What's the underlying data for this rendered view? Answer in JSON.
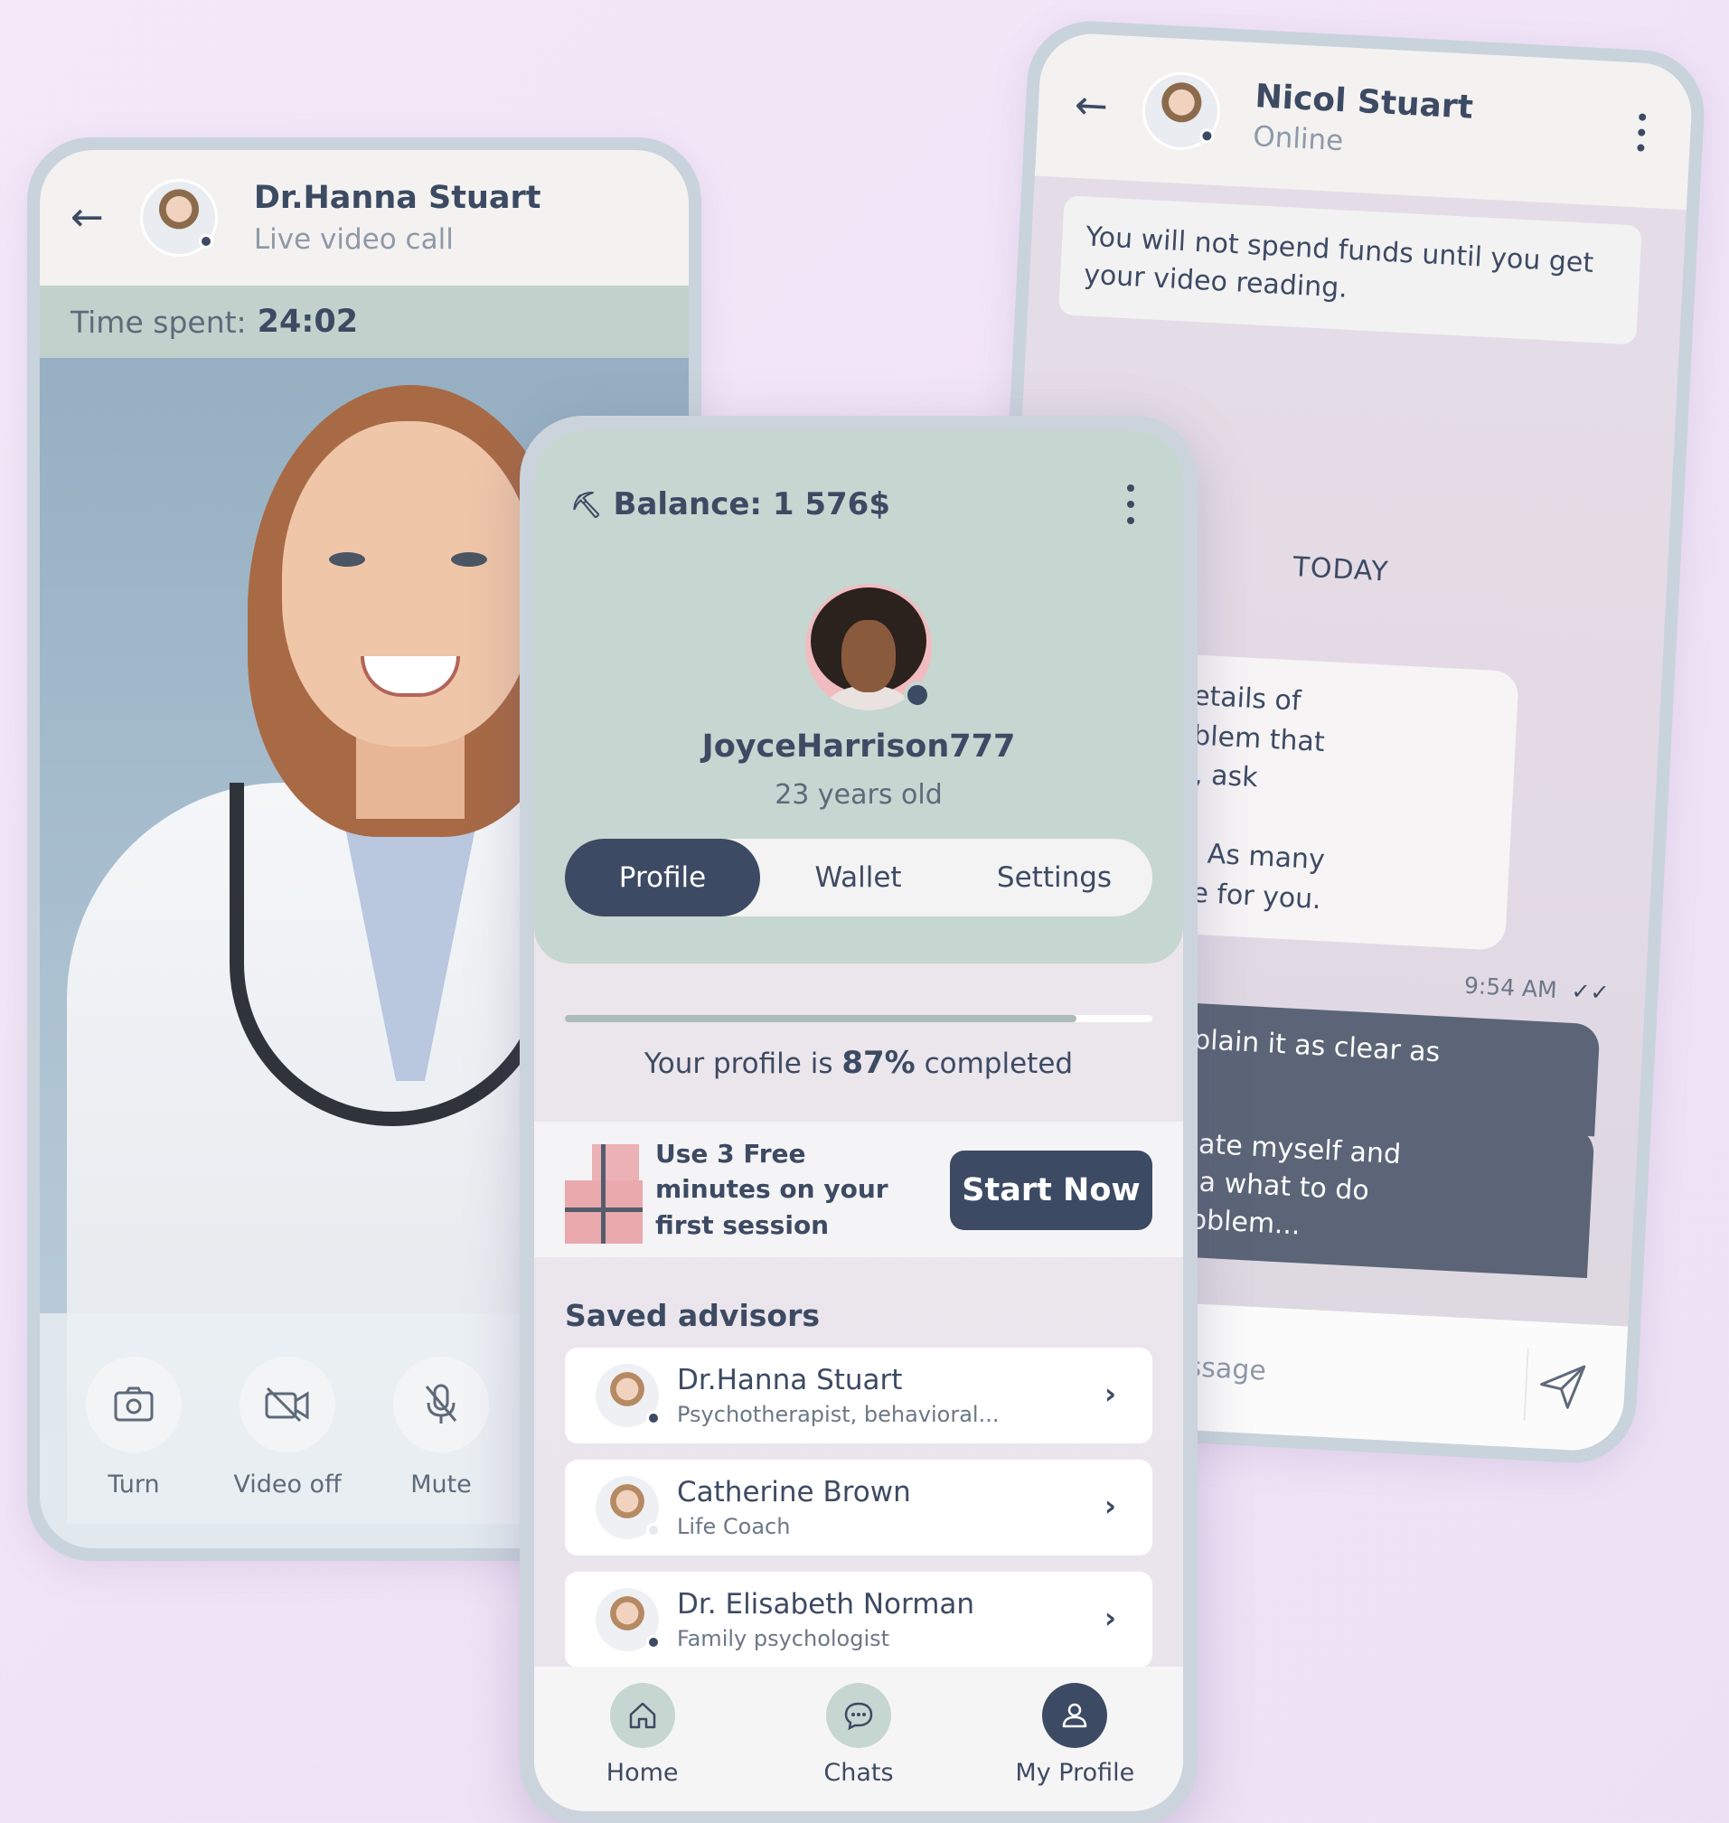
{
  "video_call": {
    "doctor_name": "Dr.Hanna Stuart",
    "status": "Live video call",
    "time_label": "Time spent:",
    "time_value": "24:02",
    "controls": [
      {
        "label": "Turn",
        "icon": "camera-rotate-icon"
      },
      {
        "label": "Video off",
        "icon": "video-off-icon"
      },
      {
        "label": "Mute",
        "icon": "mic-off-icon"
      }
    ]
  },
  "chat": {
    "contact_name": "Nicol Stuart",
    "status": "Online",
    "notice": "You will not spend funds until you get your video reading.",
    "day_separator": "TODAY",
    "incoming_message": "provide details of\nn and problem that\nd to solve, ask\nquestion.\nhe details. As many\nle. I'm here for you.",
    "timestamp": "9:54 AM",
    "outgoing_messages": [
      "'ll try to explain it as clear as\npossible...",
      "feel that I hate myself and\nhave no idea what to do\nwith this problem..."
    ],
    "input_placeholder": "message"
  },
  "profile": {
    "balance_label": "Balance: 1 576$",
    "username": "JoyceHarrison777",
    "age": "23 years old",
    "tabs": [
      "Profile",
      "Wallet",
      "Settings"
    ],
    "active_tab": "Profile",
    "completion_percent": 87,
    "completion_prefix": "Your profile is",
    "completion_value": "87%",
    "completion_suffix": "completed",
    "promo_text": "Use 3 Free minutes on your first session",
    "promo_button": "Start Now",
    "saved_title": "Saved advisors",
    "advisors": [
      {
        "name": "Dr.Hanna Stuart",
        "role": "Psychotherapist, behavioral...",
        "online": true
      },
      {
        "name": "Catherine Brown",
        "role": "Life Coach",
        "online": false
      },
      {
        "name": "Dr. Elisabeth Norman",
        "role": "Family psychologist",
        "online": true
      }
    ],
    "nav": [
      {
        "label": "Home",
        "icon": "home-icon"
      },
      {
        "label": "Chats",
        "icon": "chat-bubble-icon"
      },
      {
        "label": "My Profile",
        "icon": "user-icon"
      }
    ],
    "active_nav": "My Profile"
  },
  "colors": {
    "primary": "#3d4a63",
    "sage": "#c6d6d1",
    "background": "#f1e3f6",
    "online_dot": "#3d4a63"
  }
}
